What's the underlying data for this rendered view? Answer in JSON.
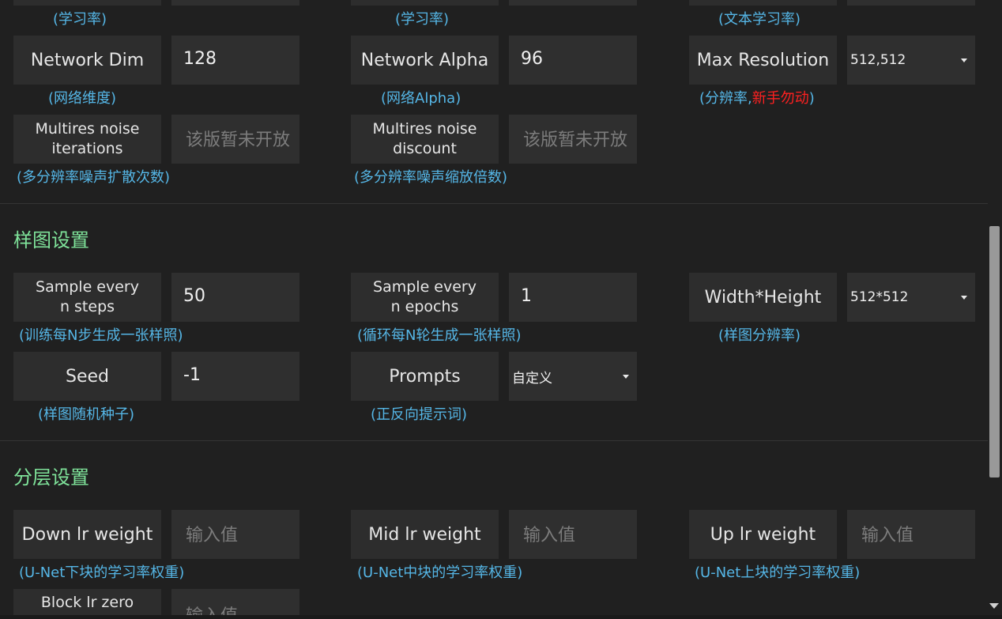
{
  "top_row": {
    "hint_1": "(学习率)",
    "hint_2": "(学习率)",
    "hint_3": "(文本学习率)"
  },
  "network": {
    "dim": {
      "label": "Network Dim",
      "value": "128",
      "hint": "(网络维度)"
    },
    "alpha": {
      "label": "Network Alpha",
      "value": "96",
      "hint": "(网络Alpha)"
    },
    "max_res": {
      "label": "Max Resolution",
      "value": "512,512",
      "hint_a": "(分辨率,",
      "hint_warn": "新手勿动",
      "hint_b": ")"
    },
    "noise_iter": {
      "label": "Multires noise\niterations",
      "placeholder": "该版暂未开放",
      "hint": "(多分辨率噪声扩散次数)"
    },
    "noise_disc": {
      "label": "Multires noise\ndiscount",
      "placeholder": "该版暂未开放",
      "hint": "(多分辨率噪声缩放倍数)"
    }
  },
  "sample_section": {
    "title": "样图设置",
    "every_steps": {
      "label": "Sample every\nn steps",
      "value": "50",
      "hint": "(训练每N步生成一张样照)"
    },
    "every_epochs": {
      "label": "Sample every\nn epochs",
      "value": "1",
      "hint": "(循环每N轮生成一张样照)"
    },
    "wh": {
      "label": "Width*Height",
      "value": "512*512",
      "hint": "(样图分辨率)"
    },
    "seed": {
      "label": "Seed",
      "value": "-1",
      "hint": "(样图随机种子)"
    },
    "prompts": {
      "label": "Prompts",
      "value": "自定义",
      "hint": "(正反向提示词)"
    }
  },
  "layer_section": {
    "title": "分层设置",
    "down": {
      "label": "Down lr weight",
      "placeholder": "输入值",
      "hint": "(U-Net下块的学习率权重)"
    },
    "mid": {
      "label": "Mid lr weight",
      "placeholder": "输入值",
      "hint": "(U-Net中块的学习率权重)"
    },
    "up": {
      "label": "Up lr weight",
      "placeholder": "输入值",
      "hint": "(U-Net上块的学习率权重)"
    },
    "block_zero": {
      "label": "Block lr zero",
      "placeholder": "输入值"
    }
  },
  "colors": {
    "background": "#202020",
    "hint": "#55b6e6",
    "section_title": "#7fe39a",
    "warn": "#ff2020"
  }
}
